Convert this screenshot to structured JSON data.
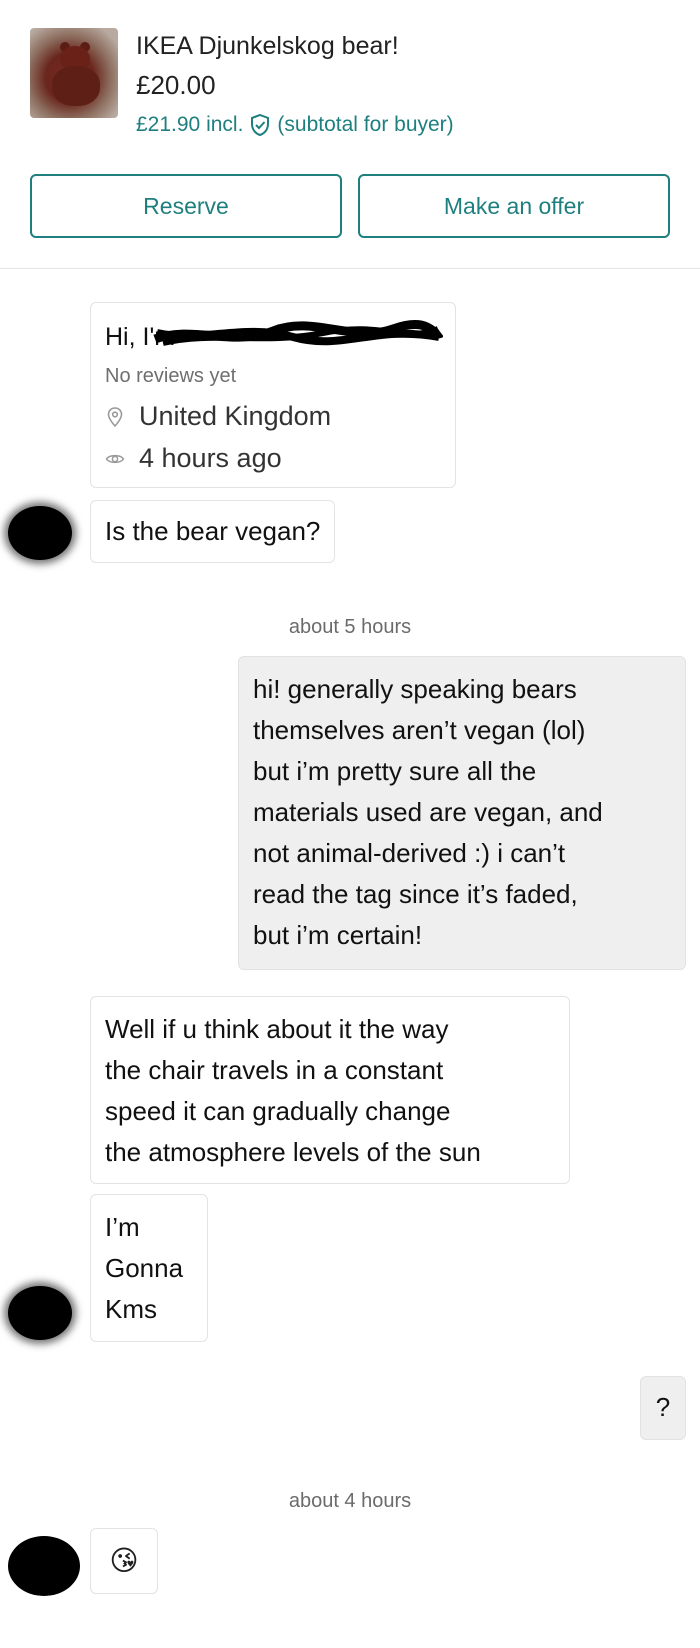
{
  "listing": {
    "title": "IKEA Djunkelskog bear!",
    "price": "£20.00",
    "price_incl": "£21.90 incl.",
    "subtotal_note": "(subtotal for buyer)",
    "accent_color": "#1f7f7f"
  },
  "actions": {
    "reserve_label": "Reserve",
    "offer_label": "Make an offer"
  },
  "profile": {
    "greeting": "Hi, I'm",
    "reviews": "No reviews yet",
    "location_icon": "location-pin-icon",
    "location": "United Kingdom",
    "seen_icon": "eye-icon",
    "last_seen": "4 hours ago"
  },
  "messages": [
    {
      "from": "buyer",
      "text": "Is the bear vegan?"
    },
    {
      "type": "timestamp",
      "text": "about 5 hours"
    },
    {
      "from": "seller",
      "lines": [
        "hi! generally speaking bears",
        "themselves aren’t vegan (lol)",
        "but i’m pretty sure all the",
        "materials used are vegan, and",
        "not animal-derived :) i can’t",
        "read the tag since it’s faded,",
        "but i’m certain!"
      ]
    },
    {
      "from": "buyer",
      "lines": [
        "Well if u think about it the way",
        "the chair travels in a constant",
        "speed it can gradually change",
        "the atmosphere levels of the sun"
      ]
    },
    {
      "from": "buyer",
      "lines": [
        "I’m",
        "Gonna",
        "Kms"
      ]
    },
    {
      "from": "seller",
      "text": "?"
    },
    {
      "type": "timestamp",
      "text": "about 4 hours"
    },
    {
      "from": "buyer",
      "text": "😘"
    }
  ]
}
